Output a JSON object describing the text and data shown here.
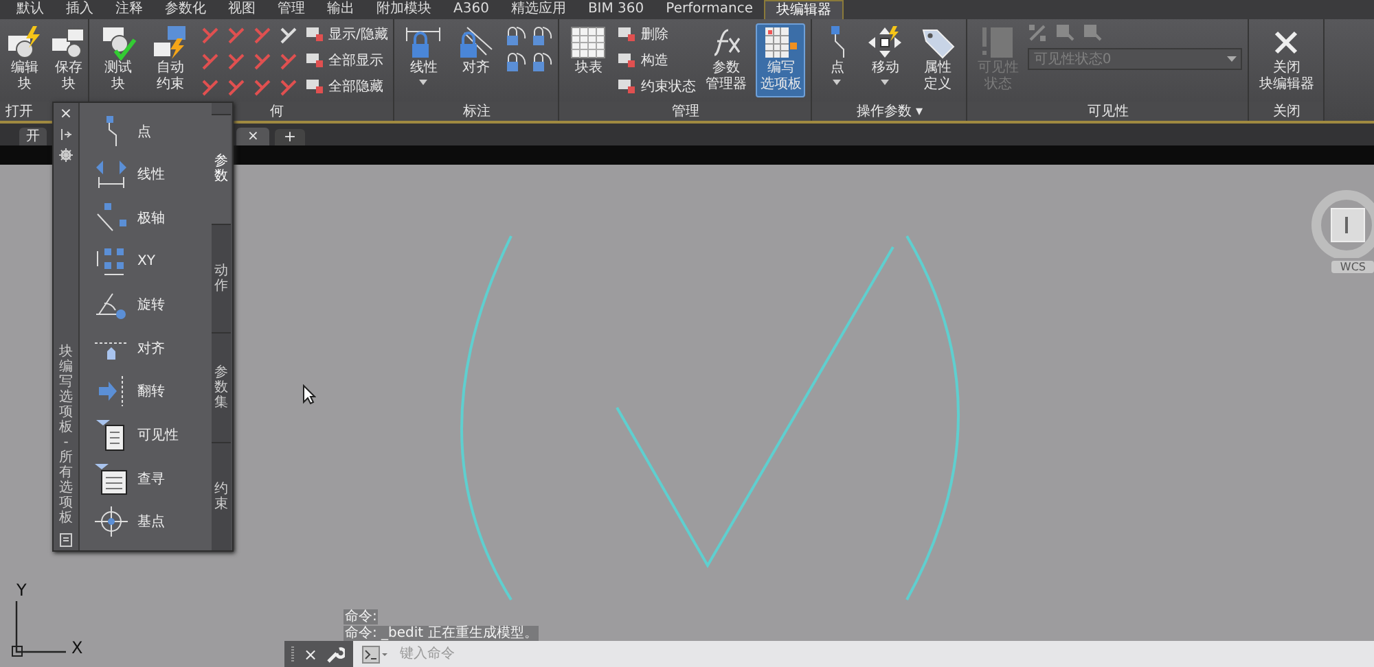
{
  "ribbon_tabs": [
    {
      "label": "默认",
      "selected": false
    },
    {
      "label": "插入",
      "selected": false
    },
    {
      "label": "注释",
      "selected": false
    },
    {
      "label": "参数化",
      "selected": false
    },
    {
      "label": "视图",
      "selected": false
    },
    {
      "label": "管理",
      "selected": false
    },
    {
      "label": "输出",
      "selected": false
    },
    {
      "label": "附加模块",
      "selected": false
    },
    {
      "label": "A360",
      "selected": false
    },
    {
      "label": "精选应用",
      "selected": false
    },
    {
      "label": "BIM 360",
      "selected": false
    },
    {
      "label": "Performance",
      "selected": false
    },
    {
      "label": "块编辑器",
      "selected": true
    }
  ],
  "panels": [
    {
      "label": "打开",
      "items": [
        {
          "kind": "large",
          "lines": [
            "编辑",
            "块"
          ],
          "dropdown": false,
          "selected": false,
          "disabled": false
        },
        {
          "kind": "large",
          "lines": [
            "保存",
            "块"
          ],
          "dropdown": false,
          "selected": false,
          "disabled": false
        }
      ]
    },
    {
      "label": "何",
      "items": [
        {
          "kind": "large",
          "lines": [
            "测试",
            "块"
          ],
          "dropdown": false,
          "selected": false,
          "disabled": false
        },
        {
          "kind": "large",
          "lines": [
            "自动",
            "约束"
          ],
          "dropdown": false,
          "selected": false,
          "disabled": false
        },
        {
          "kind": "constraints"
        },
        {
          "kind": "stack",
          "rows": [
            "显示/隐藏",
            "全部显示",
            "全部隐藏"
          ]
        }
      ]
    },
    {
      "label": "标注",
      "items": [
        {
          "kind": "large",
          "lines": [
            "线性"
          ],
          "dropdown": true,
          "selected": false,
          "disabled": false
        },
        {
          "kind": "large",
          "lines": [
            "对齐"
          ],
          "dropdown": false,
          "selected": false,
          "disabled": false
        },
        {
          "kind": "dimensions"
        }
      ]
    },
    {
      "label": "管理",
      "items": [
        {
          "kind": "large",
          "lines": [
            "块表"
          ],
          "dropdown": false,
          "selected": false,
          "disabled": false
        },
        {
          "kind": "stack",
          "rows": [
            "删除",
            "构造",
            "约束状态"
          ]
        },
        {
          "kind": "large",
          "lines": [
            "参数",
            "管理器"
          ],
          "dropdown": false,
          "selected": false,
          "disabled": false
        },
        {
          "kind": "large",
          "lines": [
            "编写",
            "选项板"
          ],
          "dropdown": false,
          "selected": true,
          "disabled": false
        }
      ]
    },
    {
      "label": "操作参数 ▾",
      "items": [
        {
          "kind": "large",
          "lines": [
            "点"
          ],
          "dropdown": true,
          "selected": false,
          "disabled": false
        },
        {
          "kind": "large",
          "lines": [
            "移动"
          ],
          "dropdown": true,
          "selected": false,
          "disabled": false
        },
        {
          "kind": "large",
          "lines": [
            "属性",
            "定义"
          ],
          "dropdown": false,
          "selected": false,
          "disabled": false
        }
      ]
    },
    {
      "label": "可见性",
      "items": [
        {
          "kind": "large",
          "lines": [
            "可见性",
            "状态"
          ],
          "dropdown": false,
          "selected": false,
          "disabled": true
        },
        {
          "kind": "combo",
          "value": "可见性状态0",
          "disabled": true
        }
      ]
    },
    {
      "label": "关闭",
      "items": [
        {
          "kind": "large",
          "lines": [
            "关闭",
            "块编辑器"
          ],
          "dropdown": false,
          "selected": false,
          "disabled": false
        }
      ]
    }
  ],
  "doc_tabs": [
    {
      "label": "开",
      "selected": false
    },
    {
      "label": "×",
      "selected": true
    }
  ],
  "new_tab": "+",
  "palette": {
    "close": "×",
    "title": "块编写选项板 - 所有选项板",
    "items": [
      {
        "label": "点"
      },
      {
        "label": "线性"
      },
      {
        "label": "极轴"
      },
      {
        "label": "XY"
      },
      {
        "label": "旋转"
      },
      {
        "label": "对齐"
      },
      {
        "label": "翻转"
      },
      {
        "label": "可见性"
      },
      {
        "label": "查寻"
      },
      {
        "label": "基点"
      }
    ],
    "tabs": [
      {
        "label": "参数",
        "selected": true
      },
      {
        "label": "动作",
        "selected": false
      },
      {
        "label": "参数集",
        "selected": false
      },
      {
        "label": "约束",
        "selected": false
      }
    ]
  },
  "viewcube": {
    "label": "WCS"
  },
  "ucs": {
    "x": "X",
    "y": "Y"
  },
  "command": {
    "history": [
      "命令:",
      "命令: _bedit 正在重生成模型。"
    ],
    "close": "×",
    "placeholder": "键入命令"
  }
}
